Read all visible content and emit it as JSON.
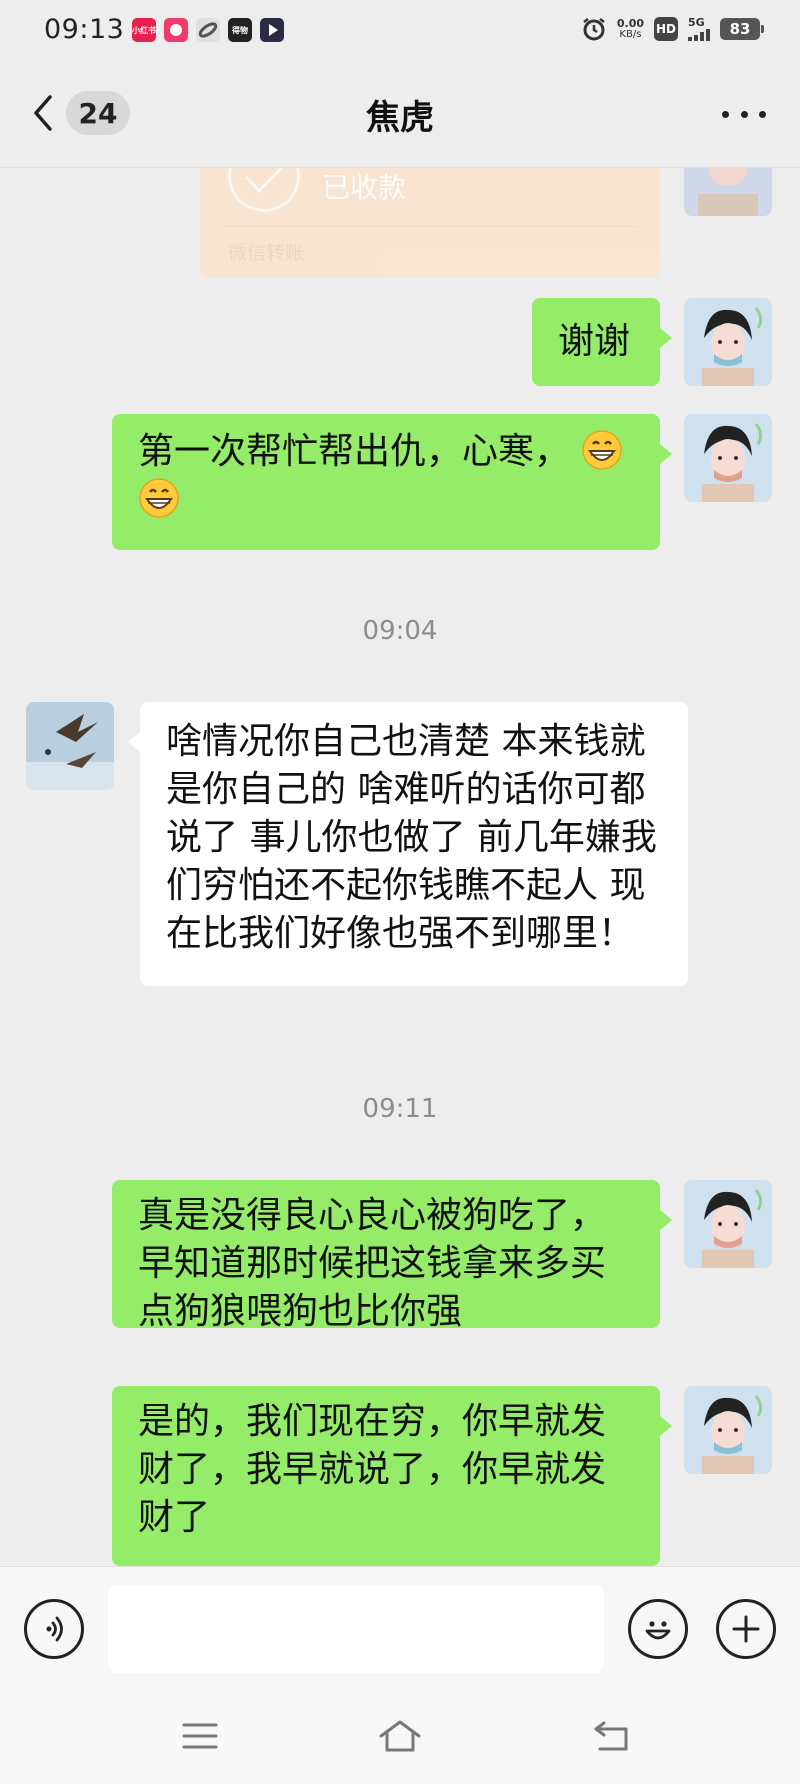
{
  "status_bar": {
    "time": "09:13",
    "notification_icons": [
      {
        "name": "video-app-icon",
        "color": "#e8204e",
        "label": "小红书"
      },
      {
        "name": "shopping-app-icon",
        "color": "#f03a6a",
        "label": ""
      },
      {
        "name": "link-app-icon",
        "color": "#555555",
        "label": ""
      },
      {
        "name": "news-app-icon",
        "color": "#222222",
        "label": "得物"
      },
      {
        "name": "play-app-icon",
        "color": "#2b2b44",
        "label": ""
      }
    ],
    "net_speed_value": "0.00",
    "net_speed_unit": "KB/s",
    "hd_label": "HD",
    "network_type": "5G",
    "battery": "83"
  },
  "header": {
    "unread_count": "24",
    "title": "焦虎"
  },
  "transfer": {
    "status": "已收款",
    "label": "微信转账"
  },
  "messages": [
    {
      "side": "me",
      "text": "谢谢"
    },
    {
      "side": "me",
      "text": "第一次帮忙帮出仇，心寒，",
      "emoji": "grinning-face"
    },
    {
      "side": "them",
      "text": "啥情况你自己也清楚   本来钱就是你自己的   啥难听的话你可都说了  事儿你也做了  前几年嫌我们穷怕还不起你钱瞧不起人   现在比我们好像也强不到哪里！"
    },
    {
      "side": "me",
      "text": "真是没得良心良心被狗吃了，早知道那时候把这钱拿来多买点狗狼喂狗也比你强"
    },
    {
      "side": "me",
      "text": "是的，我们现在穷，你早就发财了，我早就说了，你早就发财了"
    }
  ],
  "timestamps": [
    "09:04",
    "09:11"
  ],
  "input": {
    "value": "",
    "placeholder": ""
  },
  "colors": {
    "my_bubble": "#95ec69",
    "their_bubble": "#ffffff",
    "background": "#ededed",
    "transfer_card": "#fbe3cd"
  }
}
